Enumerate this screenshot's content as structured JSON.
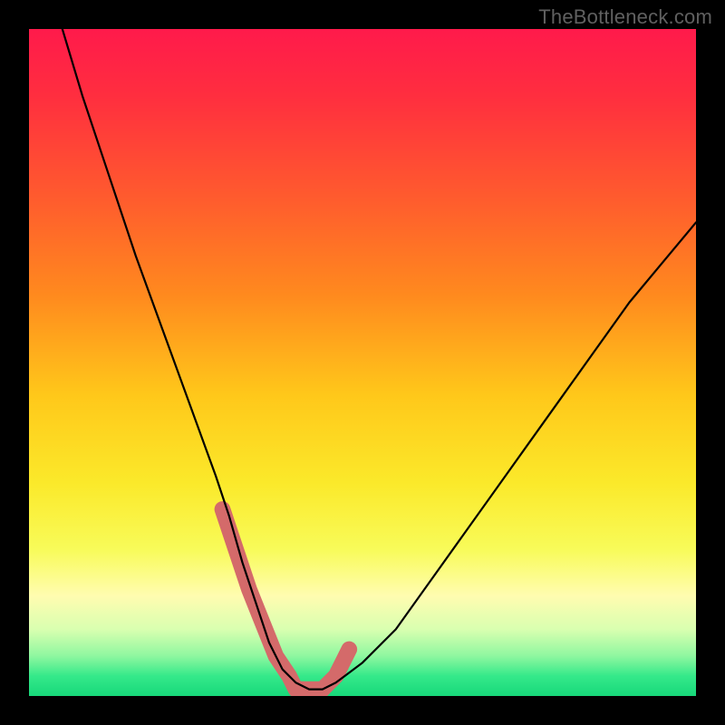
{
  "watermark": "TheBottleneck.com",
  "chart_data": {
    "type": "line",
    "title": "",
    "xlabel": "",
    "ylabel": "",
    "xlim": [
      0,
      100
    ],
    "ylim": [
      0,
      100
    ],
    "grid": false,
    "legend": false,
    "background_gradient_stops": [
      {
        "offset": 0.0,
        "color": "#ff1a4b"
      },
      {
        "offset": 0.1,
        "color": "#ff2e3f"
      },
      {
        "offset": 0.25,
        "color": "#ff5a2e"
      },
      {
        "offset": 0.4,
        "color": "#ff8a1e"
      },
      {
        "offset": 0.55,
        "color": "#ffc81a"
      },
      {
        "offset": 0.68,
        "color": "#fbe92a"
      },
      {
        "offset": 0.78,
        "color": "#f8fb59"
      },
      {
        "offset": 0.85,
        "color": "#fffcb0"
      },
      {
        "offset": 0.9,
        "color": "#d9ffb0"
      },
      {
        "offset": 0.94,
        "color": "#8ff7a0"
      },
      {
        "offset": 0.97,
        "color": "#35e98a"
      },
      {
        "offset": 1.0,
        "color": "#17d87a"
      }
    ],
    "series": [
      {
        "name": "bottleneck-curve",
        "color": "#000000",
        "x": [
          5,
          8,
          12,
          16,
          20,
          24,
          28,
          30,
          32,
          34,
          36,
          38,
          40,
          42,
          44,
          46,
          50,
          55,
          60,
          65,
          70,
          75,
          80,
          85,
          90,
          95,
          100
        ],
        "values": [
          100,
          90,
          78,
          66,
          55,
          44,
          33,
          27,
          20,
          14,
          8,
          4,
          2,
          1,
          1,
          2,
          5,
          10,
          17,
          24,
          31,
          38,
          45,
          52,
          59,
          65,
          71
        ]
      }
    ],
    "highlight_segments": [
      {
        "name": "optimal-range-left",
        "color": "#d46a6a",
        "x": [
          29,
          31,
          33,
          35,
          37,
          39,
          40,
          41
        ],
        "values": [
          28,
          22,
          16,
          11,
          6,
          3,
          1,
          1
        ]
      },
      {
        "name": "optimal-range-bottom",
        "color": "#d46a6a",
        "x": [
          41,
          42,
          43,
          44
        ],
        "values": [
          1,
          1,
          1,
          1
        ]
      },
      {
        "name": "optimal-range-right",
        "color": "#d46a6a",
        "x": [
          44,
          45,
          46,
          47,
          48
        ],
        "values": [
          1,
          2,
          3,
          5,
          7
        ]
      }
    ]
  }
}
